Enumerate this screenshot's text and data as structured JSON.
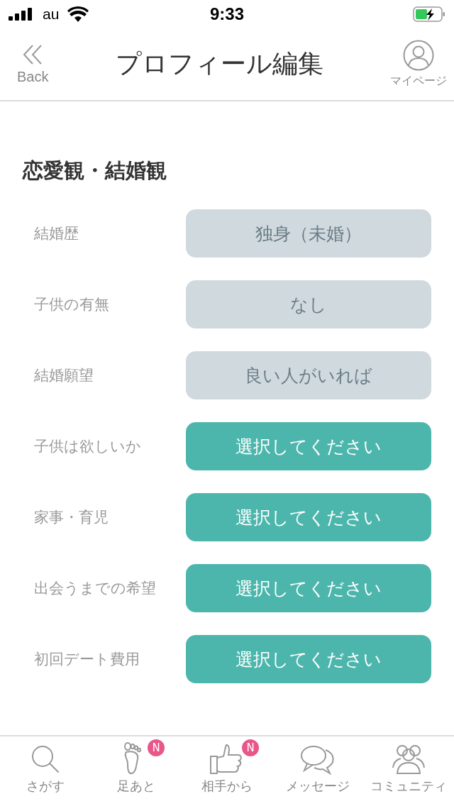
{
  "status_bar": {
    "carrier": "au",
    "time": "9:33"
  },
  "header": {
    "back_label": "Back",
    "title": "プロフィール編集",
    "mypage_label": "マイページ"
  },
  "section": {
    "title": "恋愛観・結婚観"
  },
  "rows": [
    {
      "label": "結婚歴",
      "value": "独身（未婚）",
      "kind": "answered"
    },
    {
      "label": "子供の有無",
      "value": "なし",
      "kind": "answered"
    },
    {
      "label": "結婚願望",
      "value": "良い人がいれば",
      "kind": "answered"
    },
    {
      "label": "子供は欲しいか",
      "value": "選択してください",
      "kind": "prompt"
    },
    {
      "label": "家事・育児",
      "value": "選択してください",
      "kind": "prompt"
    },
    {
      "label": "出会うまでの希望",
      "value": "選択してください",
      "kind": "prompt"
    },
    {
      "label": "初回デート費用",
      "value": "選択してください",
      "kind": "prompt"
    }
  ],
  "tab_bar": [
    {
      "label": "さがす"
    },
    {
      "label": "足あと",
      "badge": "N"
    },
    {
      "label": "相手から",
      "badge": "N"
    },
    {
      "label": "メッセージ"
    },
    {
      "label": "コミュニティ"
    }
  ]
}
